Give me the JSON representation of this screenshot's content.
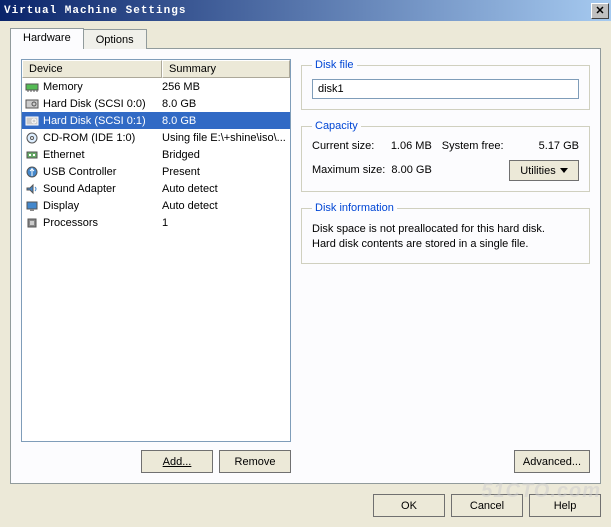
{
  "window": {
    "title": "Virtual Machine Settings",
    "close": "X"
  },
  "tabs": {
    "hardware": "Hardware",
    "options": "Options"
  },
  "list": {
    "col_device": "Device",
    "col_summary": "Summary",
    "rows": [
      {
        "device": "Memory",
        "summary": "256 MB",
        "icon": "memory"
      },
      {
        "device": "Hard Disk (SCSI 0:0)",
        "summary": "8.0 GB",
        "icon": "hdd"
      },
      {
        "device": "Hard Disk (SCSI 0:1)",
        "summary": "8.0 GB",
        "icon": "hdd",
        "selected": true
      },
      {
        "device": "CD-ROM (IDE 1:0)",
        "summary": "Using file E:\\+shine\\iso\\...",
        "icon": "cd"
      },
      {
        "device": "Ethernet",
        "summary": "Bridged",
        "icon": "net"
      },
      {
        "device": "USB Controller",
        "summary": "Present",
        "icon": "usb"
      },
      {
        "device": "Sound Adapter",
        "summary": "Auto detect",
        "icon": "sound"
      },
      {
        "device": "Display",
        "summary": "Auto detect",
        "icon": "display"
      },
      {
        "device": "Processors",
        "summary": "1",
        "icon": "cpu"
      }
    ]
  },
  "left_buttons": {
    "add": "Add...",
    "remove": "Remove"
  },
  "disk_file": {
    "legend": "Disk file",
    "value": "disk1"
  },
  "capacity": {
    "legend": "Capacity",
    "current_label": "Current size:",
    "current_value": "1.06 MB",
    "sysfree_label": "System free:",
    "sysfree_value": "5.17 GB",
    "max_label": "Maximum size:",
    "max_value": "8.00 GB",
    "utilities": "Utilities"
  },
  "disk_info": {
    "legend": "Disk information",
    "line1": "Disk space is not preallocated for this hard disk.",
    "line2": "Hard disk contents are stored in a single file."
  },
  "advanced": "Advanced...",
  "bottom": {
    "ok": "OK",
    "cancel": "Cancel",
    "help": "Help"
  },
  "watermark": "51CTO.com"
}
